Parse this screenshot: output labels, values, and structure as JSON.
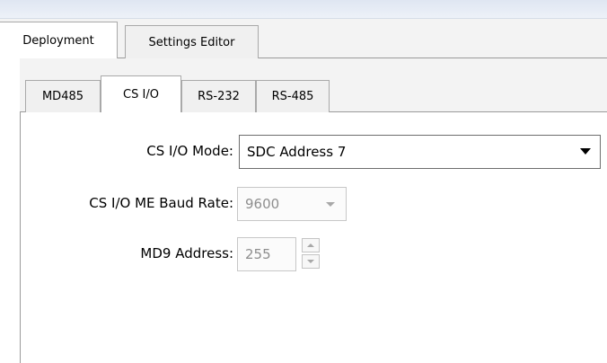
{
  "outer_tabs": [
    {
      "label": "Deployment",
      "active": true
    },
    {
      "label": "Settings Editor",
      "active": false
    }
  ],
  "inner_tabs": [
    {
      "label": "MD485",
      "active": false
    },
    {
      "label": "CS I/O",
      "active": true
    },
    {
      "label": "RS-232",
      "active": false
    },
    {
      "label": "RS-485",
      "active": false
    }
  ],
  "form": {
    "mode": {
      "label": "CS I/O Mode:",
      "value": "SDC Address 7",
      "enabled": true
    },
    "baud": {
      "label": "CS I/O ME Baud Rate:",
      "value": "9600",
      "enabled": false
    },
    "md9": {
      "label": "MD9 Address:",
      "value": "255",
      "enabled": false
    }
  },
  "icons": {
    "mode_dropdown": "chevron-down-icon",
    "baud_dropdown": "chevron-down-icon",
    "spin_up": "spinner-up-icon",
    "spin_down": "spinner-down-icon"
  },
  "colors": {
    "disabled_text": "#8e8e8e",
    "tab_border": "#a9a9a9",
    "top_strip": "#dfe6f2"
  }
}
